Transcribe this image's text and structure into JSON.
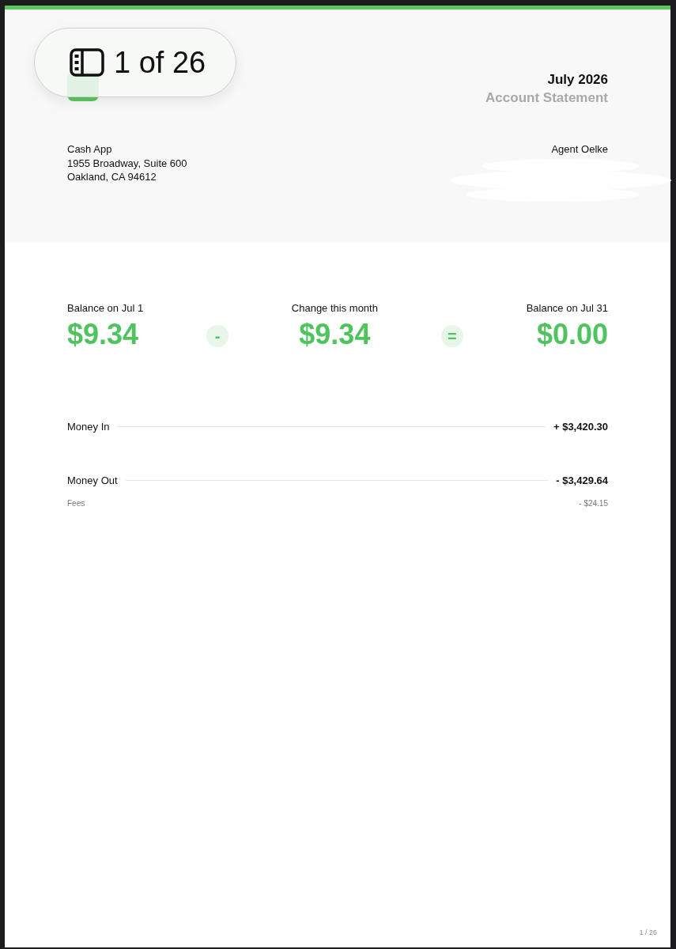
{
  "viewer_badge": {
    "label": "1 of 26"
  },
  "header": {
    "period": "July 2026",
    "title": "Account Statement",
    "sender": [
      "Cash App",
      "1955 Broadway, Suite 600",
      "Oakland, CA 94612"
    ],
    "recipient": "Agent Oelke"
  },
  "summary": [
    {
      "kind": "figure",
      "label": "Balance on Jul 1",
      "amount": "$9.34"
    },
    {
      "kind": "operator",
      "symbol": "-"
    },
    {
      "kind": "figure",
      "label": "Change this month",
      "amount": "$9.34"
    },
    {
      "kind": "operator",
      "symbol": "="
    },
    {
      "kind": "figure",
      "label": "Balance on Jul 31",
      "amount": "$0.00"
    }
  ],
  "lines": [
    {
      "kind": "main",
      "label": "Money In",
      "amount": "+ $3,420.30"
    },
    {
      "kind": "main",
      "label": "Money Out",
      "amount": "- $3,429.64"
    },
    {
      "kind": "sub",
      "label": "Fees",
      "amount": "- $24.15"
    }
  ],
  "page_number": "1 / 26"
}
